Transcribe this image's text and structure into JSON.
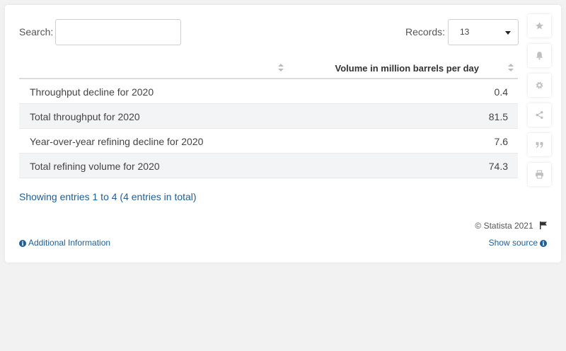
{
  "search": {
    "label": "Search:",
    "value": "",
    "placeholder": ""
  },
  "records": {
    "label": "Records:",
    "selected": "13"
  },
  "table": {
    "columns": [
      "",
      "Volume in million barrels per day"
    ],
    "rows": [
      {
        "label": "Throughput decline for 2020",
        "value": "0.4"
      },
      {
        "label": "Total throughput for 2020",
        "value": "81.5"
      },
      {
        "label": "Year-over-year refining decline for 2020",
        "value": "7.6"
      },
      {
        "label": "Total refining volume for 2020",
        "value": "74.3"
      }
    ]
  },
  "footer": {
    "entries_text": "Showing entries 1 to 4 (4 entries in total)",
    "copyright": "© Statista 2021",
    "additional_info": "Additional Information",
    "show_source": "Show source"
  },
  "sidebar": {
    "icons": [
      "star-icon",
      "bell-icon",
      "gear-icon",
      "share-icon",
      "quote-icon",
      "print-icon"
    ]
  },
  "colors": {
    "link": "#1d5f97",
    "row_alt": "#f3f4f5",
    "icon_gray": "#bfbfbf"
  }
}
